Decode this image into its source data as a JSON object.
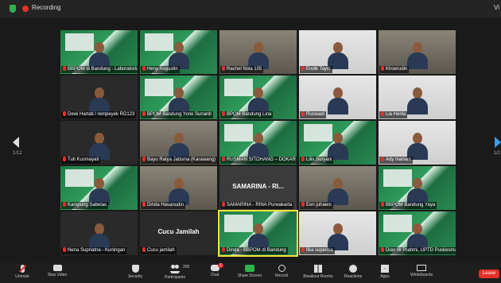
{
  "topbar": {
    "recording": "Recording",
    "view": "Vi"
  },
  "pager": {
    "left": "1/12",
    "right": "1/2"
  },
  "tiles": [
    {
      "name": "BBPOM di Bandung - Laboratorium",
      "style": "green"
    },
    {
      "name": "Heny Augustin",
      "style": "green"
    },
    {
      "name": "Rachel Nola 105",
      "style": "room"
    },
    {
      "name": "Endik Tayib",
      "style": "white"
    },
    {
      "name": "Khoerudin",
      "style": "room"
    },
    {
      "name": "Dewi Hartati / rempeyek RD123",
      "style": "dark"
    },
    {
      "name": "BPOM Bandung Yono Sunardi",
      "style": "green"
    },
    {
      "name": "BPOM Bandung Lina",
      "style": "green"
    },
    {
      "name": "Ruswadi",
      "style": "white"
    },
    {
      "name": "Lia Herlia",
      "style": "white"
    },
    {
      "name": "Tuti Kusmayati",
      "style": "dark"
    },
    {
      "name": "Bayu Ratya Jatisma (Karawang)",
      "style": "room"
    },
    {
      "name": "RUSMAN SITOHANG – DOKAR",
      "style": "green"
    },
    {
      "name": "Lilis Suryani",
      "style": "green"
    },
    {
      "name": "Ady mariani",
      "style": "white"
    },
    {
      "name": "Kampung Sabelas",
      "style": "green"
    },
    {
      "name": "Dinda Hasanudin",
      "style": "room"
    },
    {
      "name": "SAMARINA - RINA Purwakarta",
      "style": "dark2",
      "big": "SAMARINA - RI..."
    },
    {
      "name": "Een juhaeni",
      "style": "room"
    },
    {
      "name": "BBPOM Bandung Yaya",
      "style": "green"
    },
    {
      "name": "Nena Supriatna - Kuningan",
      "style": "dark"
    },
    {
      "name": "Cucu jamilah",
      "style": "dark",
      "big": "Cucu Jamilah"
    },
    {
      "name": "Dinda - BBPOM di Bandung",
      "style": "green"
    },
    {
      "name": "fika superika",
      "style": "white"
    },
    {
      "name": "Dian W Prahmi, UPTD Puskesmas",
      "style": "green"
    }
  ],
  "toolbar": {
    "unmute": "Unmute",
    "stop_video": "Stop Video",
    "security": "Security",
    "participants": "Participants",
    "participants_count": "200",
    "chat": "Chat",
    "chat_badge": "1",
    "share_screen": "Share Screen",
    "record": "Record",
    "breakout_rooms": "Breakout Rooms",
    "reactions": "Reactions",
    "apps": "Apps",
    "whiteboards": "Whiteboards",
    "leave": "Leave"
  }
}
